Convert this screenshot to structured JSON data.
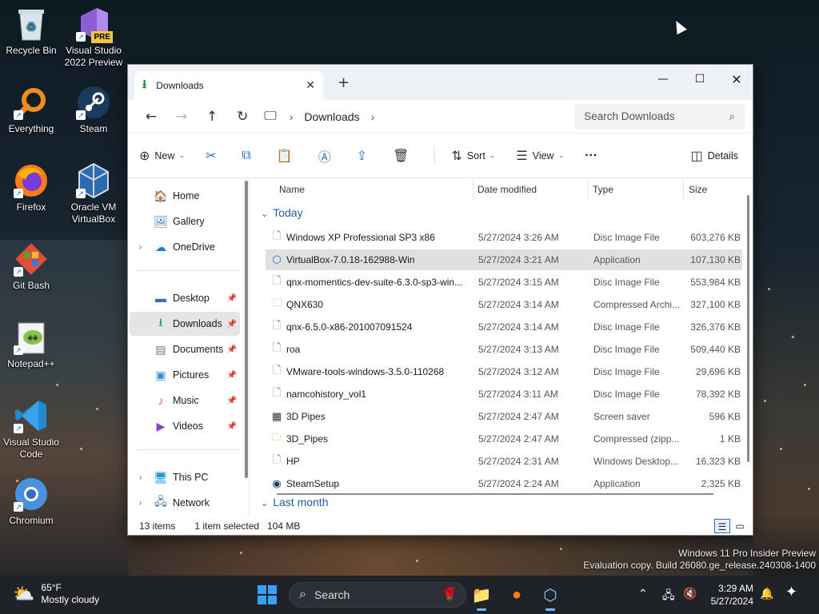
{
  "desktop": {
    "icons": [
      {
        "label": "Recycle Bin",
        "icon": "recycle-bin-icon"
      },
      {
        "label": "Visual Studio 2022 Preview",
        "badge": "PRE",
        "icon": "visual-studio-icon"
      },
      {
        "label": "Everything",
        "icon": "everything-search-icon"
      },
      {
        "label": "Steam",
        "icon": "steam-icon"
      },
      {
        "label": "Firefox",
        "icon": "firefox-icon"
      },
      {
        "label": "Oracle VM VirtualBox",
        "icon": "virtualbox-icon"
      },
      {
        "label": "Git Bash",
        "icon": "git-bash-icon"
      },
      {
        "label": "Notepad++",
        "icon": "notepad-plus-plus-icon"
      },
      {
        "label": "Visual Studio Code",
        "icon": "vscode-icon"
      },
      {
        "label": "Chromium",
        "icon": "chromium-icon"
      }
    ],
    "watermark": {
      "line1": "Windows 11 Pro Insider Preview",
      "line2": "Evaluation copy. Build 26080.ge_release.240308-1400"
    }
  },
  "explorer": {
    "tab_title": "Downloads",
    "new_tab_label": "+",
    "breadcrumb": {
      "current": "Downloads",
      "sep": "›"
    },
    "search_placeholder": "Search Downloads",
    "commands": {
      "new": "New",
      "sort": "Sort",
      "view": "View",
      "more": "···",
      "details": "Details"
    },
    "sidebar": {
      "home": "Home",
      "gallery": "Gallery",
      "onedrive": "OneDrive",
      "desktop": "Desktop",
      "downloads": "Downloads",
      "documents": "Documents",
      "pictures": "Pictures",
      "music": "Music",
      "videos": "Videos",
      "thispc": "This PC",
      "network": "Network"
    },
    "columns": {
      "name": "Name",
      "date": "Date modified",
      "type": "Type",
      "size": "Size"
    },
    "groups": {
      "today": "Today",
      "last_month": "Last month"
    },
    "files": [
      {
        "name": "Windows XP Professional SP3 x86",
        "date": "5/27/2024 3:26 AM",
        "type": "Disc Image File",
        "size": "603,276 KB",
        "icon": "disc-image-icon"
      },
      {
        "name": "VirtualBox-7.0.18-162988-Win",
        "date": "5/27/2024 3:21 AM",
        "type": "Application",
        "size": "107,130 KB",
        "icon": "virtualbox-installer-icon",
        "selected": true
      },
      {
        "name": "qnx-momentics-dev-suite-6.3.0-sp3-win...",
        "date": "5/27/2024 3:15 AM",
        "type": "Disc Image File",
        "size": "553,984 KB",
        "icon": "disc-image-icon"
      },
      {
        "name": "QNX630",
        "date": "5/27/2024 3:14 AM",
        "type": "Compressed Archi...",
        "size": "327,100 KB",
        "icon": "zip-folder-icon"
      },
      {
        "name": "qnx-6.5.0-x86-201007091524",
        "date": "5/27/2024 3:14 AM",
        "type": "Disc Image File",
        "size": "326,376 KB",
        "icon": "disc-image-icon"
      },
      {
        "name": "roa",
        "date": "5/27/2024 3:13 AM",
        "type": "Disc Image File",
        "size": "509,440 KB",
        "icon": "disc-image-icon"
      },
      {
        "name": "VMware-tools-windows-3.5.0-110268",
        "date": "5/27/2024 3:12 AM",
        "type": "Disc Image File",
        "size": "29,696 KB",
        "icon": "disc-image-icon"
      },
      {
        "name": "namcohistory_vol1",
        "date": "5/27/2024 3:11 AM",
        "type": "Disc Image File",
        "size": "78,392 KB",
        "icon": "disc-image-icon"
      },
      {
        "name": "3D Pipes",
        "date": "5/27/2024 2:47 AM",
        "type": "Screen saver",
        "size": "596 KB",
        "icon": "screensaver-icon"
      },
      {
        "name": "3D_Pipes",
        "date": "5/27/2024 2:47 AM",
        "type": "Compressed (zipp...",
        "size": "1 KB",
        "icon": "zip-folder-icon"
      },
      {
        "name": "HP",
        "date": "5/27/2024 2:31 AM",
        "type": "Windows Desktop...",
        "size": "16,323 KB",
        "icon": "desktop-theme-icon"
      },
      {
        "name": "SteamSetup",
        "date": "5/27/2024 2:24 AM",
        "type": "Application",
        "size": "2,325 KB",
        "icon": "steam-icon"
      }
    ],
    "status": {
      "count": "13 items",
      "selected": "1 item selected",
      "size": "104 MB"
    }
  },
  "taskbar": {
    "weather_temp": "65°F",
    "weather_desc": "Mostly cloudy",
    "search_placeholder": "Search",
    "time": "3:29 AM",
    "date": "5/27/2024",
    "accent": "#3aa0ff"
  }
}
